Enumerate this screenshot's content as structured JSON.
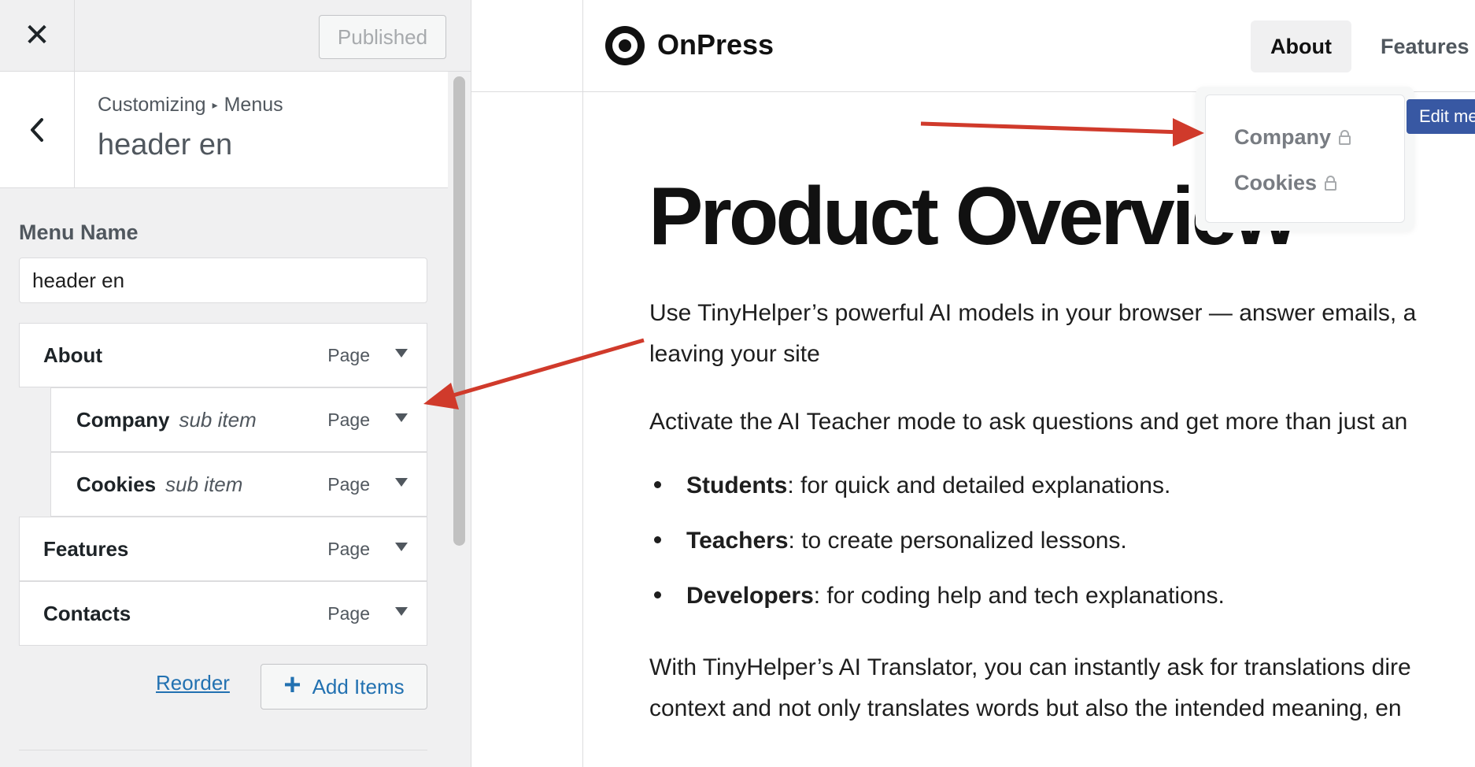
{
  "topbar": {
    "close_symbol": "✕",
    "published_label": "Published"
  },
  "section": {
    "breadcrumb_parent": "Customizing",
    "breadcrumb_separator": "▸",
    "breadcrumb_current": "Menus",
    "title": "header en"
  },
  "menu_name": {
    "label": "Menu Name",
    "value": "header en"
  },
  "menu_items": [
    {
      "title": "About",
      "sub": "",
      "type": "Page"
    },
    {
      "title": "Company",
      "sub": "sub item",
      "type": "Page"
    },
    {
      "title": "Cookies",
      "sub": "sub item",
      "type": "Page"
    },
    {
      "title": "Features",
      "sub": "",
      "type": "Page"
    },
    {
      "title": "Contacts",
      "sub": "",
      "type": "Page"
    }
  ],
  "actions": {
    "reorder_label": "Reorder",
    "add_items_label": "Add Items"
  },
  "preview": {
    "site_name": "OnPress",
    "nav": {
      "about": "About",
      "features": "Features"
    },
    "dropdown": [
      "Company",
      "Cookies"
    ],
    "edit_menu_label": "Edit menu",
    "heading": "Product Overview",
    "para1_line1": "Use TinyHelper’s powerful AI models in your browser — answer emails, a",
    "para1_line2": "leaving your site",
    "para2": "Activate the AI Teacher mode to ask questions and get more than just an",
    "bullets": [
      {
        "bold": "Students",
        "text": ": for quick and detailed explanations."
      },
      {
        "bold": "Teachers",
        "text": ": to create personalized lessons."
      },
      {
        "bold": "Developers",
        "text": ": for coding help and tech explanations."
      }
    ],
    "para3_line1": "With TinyHelper’s AI Translator, you can instantly ask for translations dire",
    "para3_line2": "context and not only translates words but also the intended meaning, en"
  },
  "colors": {
    "accent": "#2271b1",
    "annotation_arrow": "#d03a2b",
    "edit_button": "#3858a3"
  }
}
